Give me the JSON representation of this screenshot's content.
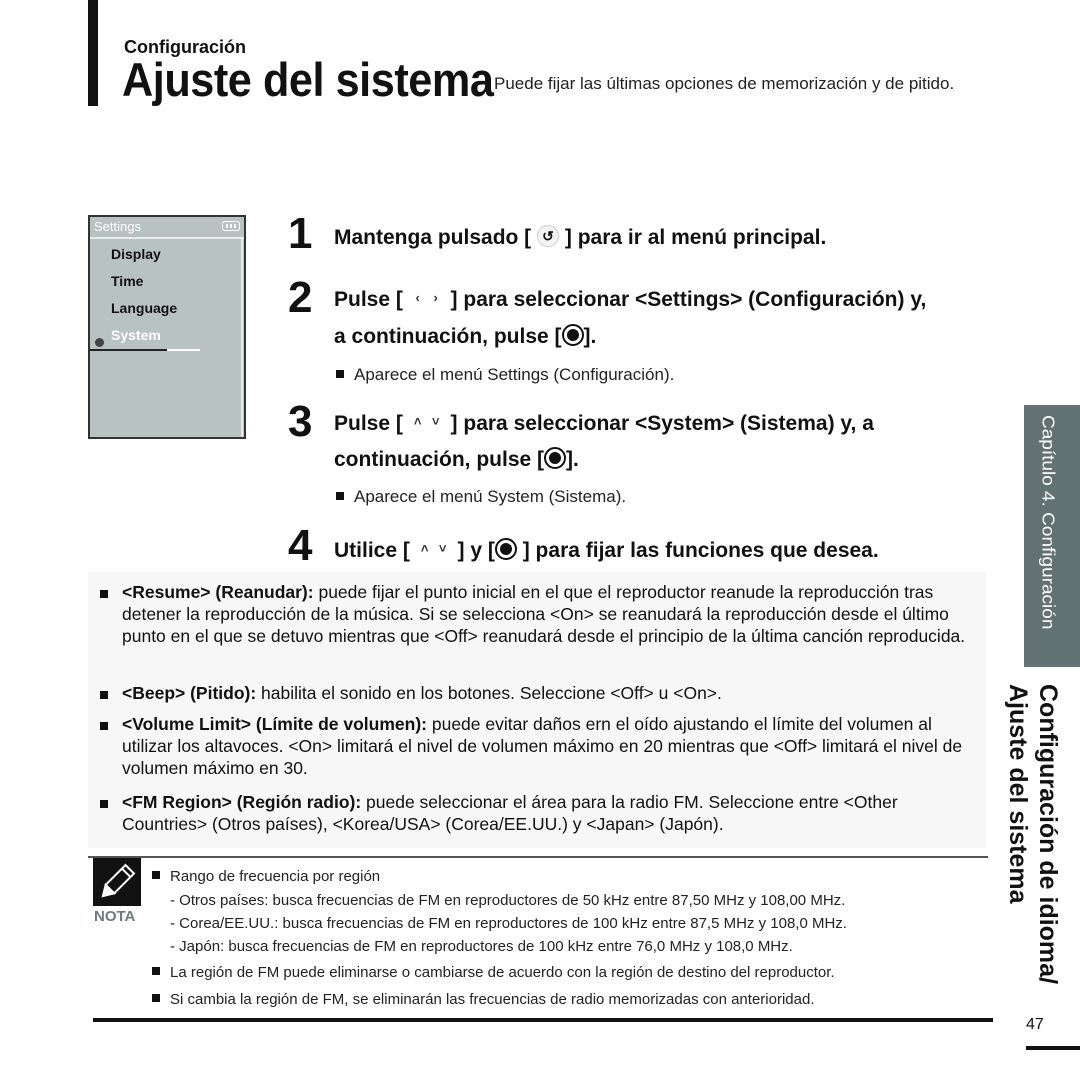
{
  "header": {
    "section": "Configuración",
    "title": "Ajuste del sistema",
    "subtitle": "Puede fijar las últimas opciones de memorización y de pitido."
  },
  "device_screen": {
    "title": "Settings",
    "battery_icon": "battery-icon",
    "items": [
      "Display",
      "Time",
      "Language",
      "System"
    ],
    "selected": "System"
  },
  "steps": [
    {
      "num": "1",
      "pre": "Mantenga pulsado [",
      "icon": "back-icon",
      "post": "] para ir al menú principal."
    },
    {
      "num": "2",
      "pre": "Pulse [",
      "icon": "left-right-icon",
      "mid": "] para seleccionar <Settings> (Configuración) y,",
      "line2_pre": "a continuación, pulse [",
      "line2_post": "].",
      "note": "Aparece el menú Settings (Configuración)."
    },
    {
      "num": "3",
      "pre": "Pulse [",
      "icon": "up-down-icon",
      "mid": "] para seleccionar <System> (Sistema) y, a",
      "line2_pre": "continuación, pulse [",
      "line2_post": "].",
      "note": "Aparece el menú System (Sistema)."
    },
    {
      "num": "4",
      "pre": "Utilice [",
      "icon": "up-down-icon",
      "mid": "] y [",
      "post": "] para fijar las funciones que desea."
    }
  ],
  "options": [
    {
      "bold": "<Resume> (Reanudar):",
      "text": " puede fijar el punto inicial en el que el reproductor reanude la reproducción tras detener la reproducción de la música. Si se selecciona <On> se reanudará la reproducción desde el último punto en el que se detuvo mientras que <Off> reanudará desde el principio de la última canción reproducida."
    },
    {
      "bold": "<Beep> (Pitido):",
      "text": " habilita el sonido en los botones. Seleccione <Off> u <On>."
    },
    {
      "bold": "<Volume Limit> (Límite de volumen):",
      "text": " puede evitar daños ern el oído ajustando el límite del volumen al utilizar los altavoces. <On> limitará el nivel de volumen máximo en 20 mientras que <Off> limitará el nivel de volumen máximo en 30."
    },
    {
      "bold": "<FM Region> (Región radio):",
      "text": " puede seleccionar el área para la radio FM. Seleccione entre <Other Countries> (Otros países), <Korea/USA> (Corea/EE.UU.) y <Japan> (Japón)."
    }
  ],
  "note": {
    "label": "NOTA",
    "icon": "pencil-icon",
    "heading": "Rango de frecuencia por región",
    "sub_items": [
      "- Otros países: busca frecuencias de FM en reproductores de 50 kHz entre 87,50 MHz y 108,00 MHz.",
      "- Corea/EE.UU.: busca frecuencias de FM en reproductores de 100 kHz entre 87,5 MHz y 108,0 MHz.",
      "- Japón: busca frecuencias de FM en reproductores de 100 kHz entre 76,0 MHz y 108,0 MHz."
    ],
    "bullets": [
      "La región de FM puede eliminarse o cambiarse de acuerdo con la región de destino del reproductor.",
      "Si cambia la región de FM, se eliminarán las frecuencias de radio memorizadas con anterioridad."
    ]
  },
  "sidebar": {
    "chapter": "Capítulo 4. Configuración",
    "title_line1": "Configuración de idioma/",
    "title_line2": "Ajuste del sistema",
    "page_number": "47"
  }
}
